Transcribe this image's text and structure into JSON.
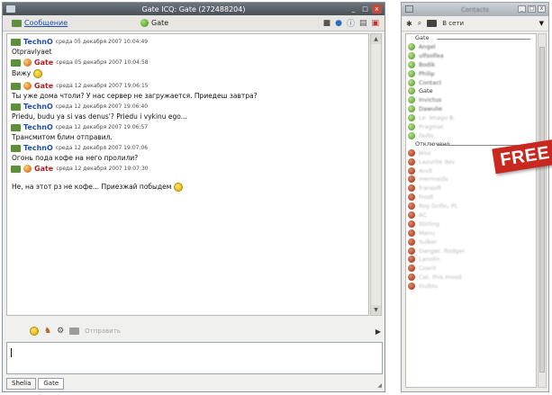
{
  "chat_window": {
    "title": "Gate ICQ: Gate (272488204)",
    "window_buttons": [
      "_",
      "□",
      "x"
    ],
    "toolbar": {
      "message_label": "Сообщение",
      "contact_label": "Gate",
      "icons": [
        "filter-icon",
        "globe-icon",
        "info-icon",
        "history-icon",
        "block-icon"
      ]
    },
    "messages": [
      {
        "sender": "TechnO",
        "time": "среда 05 декабря 2007 10:04:49",
        "text": "Otpravlyaet",
        "smile": false,
        "type": "in"
      },
      {
        "sender": "Gate",
        "time": "среда 05 декабря 2007 10:04:58",
        "text": "Вижу",
        "smile": true,
        "type": "out"
      },
      {
        "sender": "Gate",
        "time": "среда 12 декабря 2007 19:06:15",
        "text": "Ты уже дома чтоли? У нас сервер не загружается. Приедеш завтра?",
        "smile": false,
        "type": "out"
      },
      {
        "sender": "TechnO",
        "time": "среда 12 декабря 2007 19:06:40",
        "text": "Priedu, budu ya si vas denus'? Priedu i vykinu ego...",
        "smile": false,
        "type": "in"
      },
      {
        "sender": "TechnO",
        "time": "среда 12 декабря 2007 19:06:57",
        "text": "Трансмитом блин отправил.",
        "smile": false,
        "type": "in"
      },
      {
        "sender": "TechnO",
        "time": "среда 12 декабря 2007 19:07:06",
        "text": "Огонь пода кофе на него пролили?",
        "smile": false,
        "type": "in"
      },
      {
        "sender": "Gate",
        "time": "среда 12 декабря 2007 19:07:30",
        "text": "Не, на этот рз не кофе... Приезжай побыдем",
        "smile": true,
        "type": "out"
      }
    ],
    "composer": {
      "send_label": "Отправить",
      "value": ""
    },
    "tabs": [
      "Shelia",
      "Gate"
    ]
  },
  "contact_list": {
    "title": "Contacts",
    "toolbar": {
      "online_label": "В сети"
    },
    "groups": [
      {
        "name": "Gate",
        "contacts": [
          {
            "name": "Angel",
            "status": "on",
            "style": "blur"
          },
          {
            "name": "ulfsolfea",
            "status": "on",
            "style": "blur"
          },
          {
            "name": "Bodik",
            "status": "on",
            "style": "blur"
          },
          {
            "name": "Philip",
            "status": "on",
            "style": "blur"
          },
          {
            "name": "Contact",
            "status": "on",
            "style": "blur"
          },
          {
            "name": "Gate",
            "status": "on",
            "style": "normal"
          },
          {
            "name": "Invictus",
            "status": "on",
            "style": "blur"
          },
          {
            "name": "Dawulie",
            "status": "on",
            "style": "blur"
          },
          {
            "name": "Le. Imago B.",
            "status": "on",
            "style": "faint"
          },
          {
            "name": "Pragmat",
            "status": "on",
            "style": "faint"
          },
          {
            "name": "Dollo",
            "status": "on",
            "style": "faint"
          }
        ]
      },
      {
        "name": "Отключено",
        "contacts": [
          {
            "name": "Jesa",
            "status": "off",
            "style": "faint"
          },
          {
            "name": "Lazurite dev",
            "status": "off",
            "style": "faint"
          },
          {
            "name": "Arvit",
            "status": "off",
            "style": "faint"
          },
          {
            "name": "mermaids",
            "status": "off",
            "style": "faint"
          },
          {
            "name": "fransoft",
            "status": "off",
            "style": "faint"
          },
          {
            "name": "Frodt",
            "status": "off",
            "style": "faint"
          },
          {
            "name": "Roy Grifin, PL",
            "status": "off",
            "style": "faint"
          },
          {
            "name": "AC",
            "status": "off",
            "style": "faint"
          },
          {
            "name": "Stirling",
            "status": "off",
            "style": "faint"
          },
          {
            "name": "Manu",
            "status": "off",
            "style": "faint"
          },
          {
            "name": "Sulker",
            "status": "off",
            "style": "faint"
          },
          {
            "name": "Danger, Rodger",
            "status": "off",
            "style": "faint"
          },
          {
            "name": "Lanolin",
            "status": "off",
            "style": "faint"
          },
          {
            "name": "Coarit",
            "status": "off",
            "style": "faint"
          },
          {
            "name": "Cat. this mood",
            "status": "off",
            "style": "faint"
          },
          {
            "name": "Guibiu",
            "status": "off",
            "style": "faint"
          }
        ]
      }
    ]
  },
  "banner": {
    "text": "FREE"
  }
}
